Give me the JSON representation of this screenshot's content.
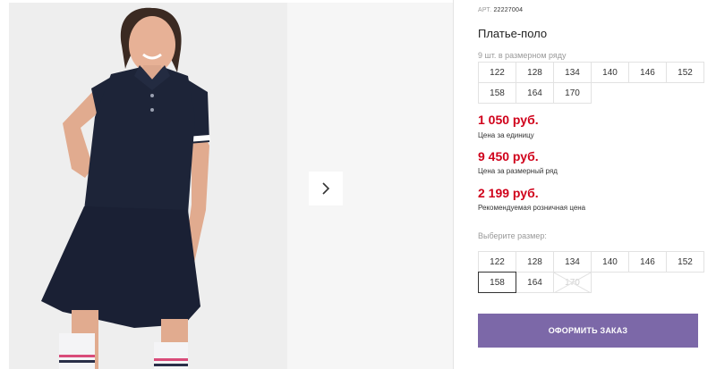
{
  "product": {
    "art_label": "АРТ.",
    "art_number": "22227004",
    "title": "Платье-поло",
    "row_note": "9 шт. в размерном ряду",
    "row_sizes": [
      "122",
      "128",
      "134",
      "140",
      "146",
      "152",
      "158",
      "164",
      "170"
    ],
    "prices": [
      {
        "value": "1 050 руб.",
        "note": "Цена за единицу"
      },
      {
        "value": "9 450 руб.",
        "note": "Цена за размерный ряд"
      },
      {
        "value": "2 199 руб.",
        "note": "Рекомендуемая розничная цена"
      }
    ],
    "choose_label": "Выберите размер:",
    "pick_sizes": [
      {
        "label": "122",
        "state": "available"
      },
      {
        "label": "128",
        "state": "available"
      },
      {
        "label": "134",
        "state": "available"
      },
      {
        "label": "140",
        "state": "available"
      },
      {
        "label": "146",
        "state": "available"
      },
      {
        "label": "152",
        "state": "available"
      },
      {
        "label": "158",
        "state": "selected"
      },
      {
        "label": "164",
        "state": "available"
      },
      {
        "label": "170",
        "state": "disabled"
      }
    ],
    "order_button": "ОФОРМИТЬ ЗАКАЗ"
  },
  "colors": {
    "price": "#d0021b",
    "button": "#7c68a8",
    "dress": "#1d2438"
  },
  "icons": {
    "next": "chevron-right-icon"
  }
}
